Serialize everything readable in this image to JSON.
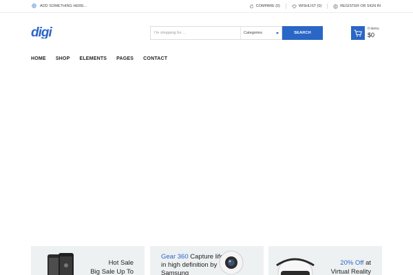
{
  "topbar": {
    "promo_text": "ADD SOMETHING HERE...",
    "compare_label": "COMPARE (0)",
    "wishlist_label": "WISHLIST (0)",
    "account_label": "REGISTER OR SIGN IN"
  },
  "header": {
    "logo_text": "digi",
    "search_placeholder": "I'm shopping for ...",
    "category_label": "Categories",
    "search_button": "SEARCH",
    "cart_items": "0 items",
    "cart_total": "$0"
  },
  "nav": {
    "items": [
      "HOME",
      "SHOP",
      "ELEMENTS",
      "PAGES",
      "CONTACT"
    ]
  },
  "banners": [
    {
      "line1": "Hot Sale",
      "line2": "Big Sale Up To"
    },
    {
      "accent": "Gear 360",
      "rest": " Capture life in high definition by Samsung"
    },
    {
      "accent": "20% Off",
      "rest": " at",
      "line2": "Virtual Reality"
    }
  ],
  "colors": {
    "brand": "#2a66c6",
    "banner_bg": "#eef1f2"
  },
  "icons": {
    "promo": "globe-icon",
    "compare": "refresh-icon",
    "wishlist": "heart-icon",
    "account": "user-icon",
    "cart": "shopping-cart-icon"
  }
}
